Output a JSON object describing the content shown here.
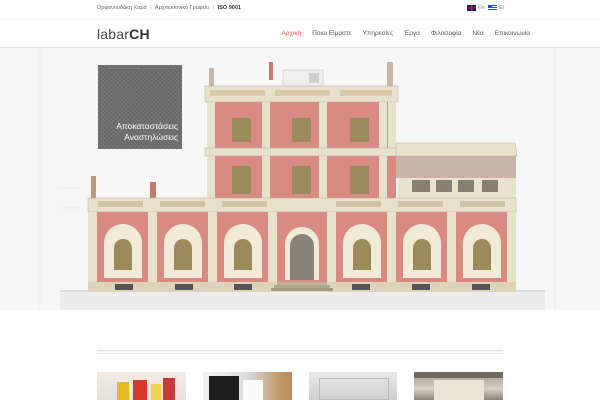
{
  "topbar": {
    "company": "Ορφανουδάκη Χαρά",
    "separator": "|",
    "description": "Αρχιτεκτονικό Γραφείο",
    "certification": "ISO 9001",
    "languages": [
      {
        "code": "En",
        "flag": "uk-flag"
      },
      {
        "code": "El",
        "flag": "greece-flag"
      }
    ]
  },
  "header": {
    "logo_light": "labar",
    "logo_bold": "CH",
    "nav": [
      {
        "label": "Αρχική",
        "active": true
      },
      {
        "label": "Ποιοι Είμαστε",
        "active": false
      },
      {
        "label": "Υπηρεσίες",
        "active": false
      },
      {
        "label": "Έργα",
        "active": false
      },
      {
        "label": "Φιλοσοφία",
        "active": false
      },
      {
        "label": "Νέα",
        "active": false
      },
      {
        "label": "Επικοινωνία",
        "active": false
      }
    ]
  },
  "hero": {
    "caption_line1": "Αποκαταστάσεις",
    "caption_line2": "Αναστηλώσεις",
    "caption_bg_color": "#6e6e6e",
    "building_colors": {
      "stone": "#e8e2cc",
      "brick": "#d98b83",
      "window": "#9c8a5c",
      "roof": "#c9b5a8"
    }
  },
  "thumbnails": [
    {
      "name": "colorful-interior"
    },
    {
      "name": "modern-kitchen"
    },
    {
      "name": "minimal-room"
    },
    {
      "name": "vaulted-hall"
    }
  ],
  "colors": {
    "accent": "#d9534f",
    "text": "#555555"
  }
}
